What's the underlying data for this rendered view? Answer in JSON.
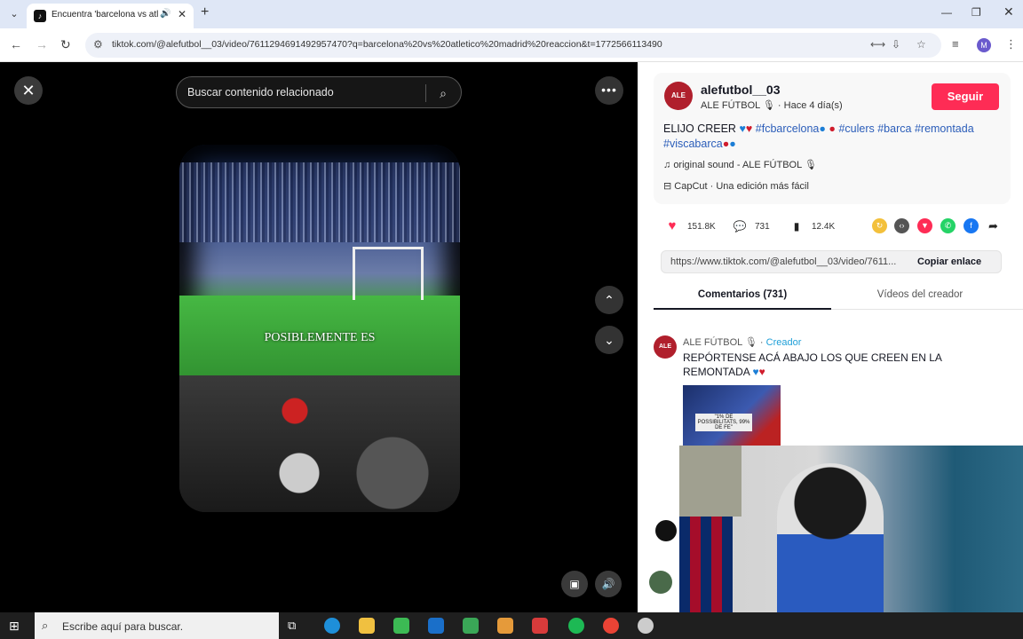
{
  "browser": {
    "tab_title": "Encuentra 'barcelona vs atle",
    "url": "tiktok.com/@alefutbol__03/video/7611294691492957470?q=barcelona%20vs%20atletico%20madrid%20reaccion&t=1772566113490",
    "profile_initial": "M"
  },
  "video": {
    "search_placeholder": "Buscar contenido relacionado",
    "caption_overlay": "POSIBLEMENTE ES"
  },
  "post": {
    "avatar_text": "ALE FÚTBOL",
    "username": "alefutbol__03",
    "nickname_line": "ALE FÚTBOL 🎙 · Hace 4 día(s)",
    "follow_label": "Seguir",
    "desc_prefix": "ELIJO CREER",
    "tags": [
      "#fcbarcelona",
      "#culers",
      "#barca",
      "#remontada",
      "#viscabarca"
    ],
    "sound": "original sound - ALE FÚTBOL 🎙",
    "capcut": "CapCut · Una edición más fácil",
    "likes": "151.8K",
    "comments": "731",
    "saves": "12.4K",
    "link_url": "https://www.tiktok.com/@alefutbol__03/video/7611...",
    "copy_label": "Copiar enlace"
  },
  "tabs": {
    "comments": "Comentarios (731)",
    "creator_videos": "Vídeos del creador"
  },
  "comment": {
    "author": "ALE FÚTBOL 🎙",
    "creator_badge": "Creador",
    "text": "REPÓRTENSE ACÁ ABAJO LOS QUE CREEN EN LA REMONTADA",
    "image_text": "\"1% DE POSSIBILITATS, 99% DE FE\""
  },
  "taskbar": {
    "search_placeholder": "Escribe aquí para buscar."
  },
  "colors": {
    "follow": "#fe2c55",
    "hashtag": "#2b5db9",
    "creator_badge": "#1e9fd8"
  }
}
